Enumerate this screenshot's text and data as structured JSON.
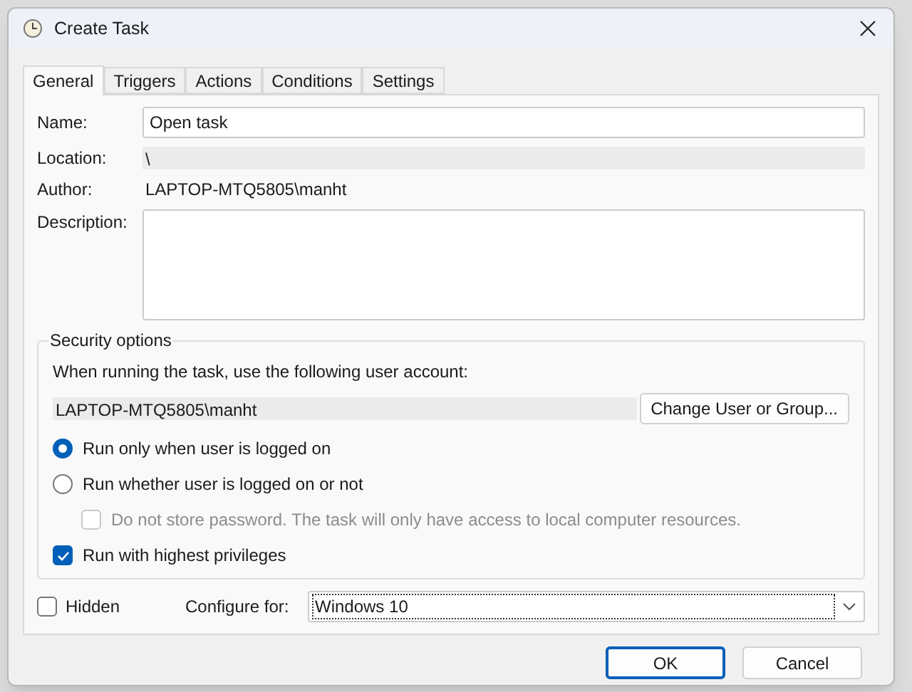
{
  "window": {
    "title": "Create Task"
  },
  "tabs": [
    {
      "label": "General",
      "selected": true
    },
    {
      "label": "Triggers",
      "selected": false
    },
    {
      "label": "Actions",
      "selected": false
    },
    {
      "label": "Conditions",
      "selected": false
    },
    {
      "label": "Settings",
      "selected": false
    }
  ],
  "general": {
    "name_label": "Name:",
    "name_value": "Open task",
    "location_label": "Location:",
    "location_value": "\\",
    "author_label": "Author:",
    "author_value": "LAPTOP-MTQ5805\\manht",
    "description_label": "Description:"
  },
  "security": {
    "title": "Security options",
    "account_prompt": "When running the task, use the following user account:",
    "account": "LAPTOP-MTQ5805\\manht",
    "change_button": "Change User or Group...",
    "options": [
      {
        "kind": "radio",
        "label": "Run only when user is logged on",
        "checked": true,
        "disabled": false,
        "indented": false
      },
      {
        "kind": "radio",
        "label": "Run whether user is logged on or not",
        "checked": false,
        "disabled": false,
        "indented": false
      },
      {
        "kind": "checkbox",
        "label": "Do not store password.  The task will only have access to local computer resources.",
        "checked": false,
        "disabled": true,
        "indented": true
      },
      {
        "kind": "checkbox",
        "label": "Run with highest privileges",
        "checked": true,
        "disabled": false,
        "indented": false
      }
    ]
  },
  "hidden": {
    "label": "Hidden",
    "checked": false
  },
  "configure": {
    "label": "Configure for:",
    "value": "Windows 10"
  },
  "buttons": [
    {
      "label": "OK",
      "default": true
    },
    {
      "label": "Cancel",
      "default": false
    }
  ]
}
